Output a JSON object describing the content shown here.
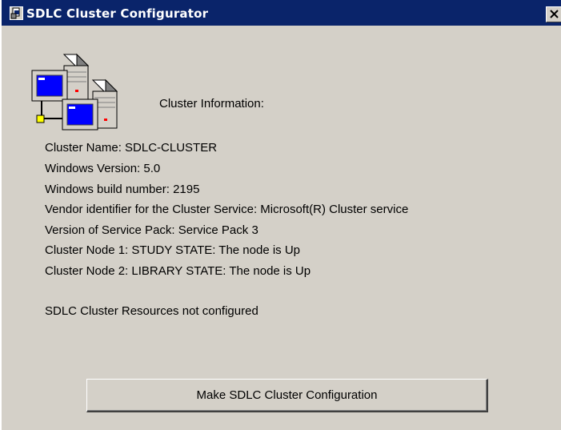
{
  "window": {
    "title": "SDLC Cluster Configurator",
    "close_glyph": "✕",
    "app_icon": "application-icon"
  },
  "main": {
    "icon": "server-cluster-icon",
    "header": "Cluster Information:",
    "info_lines": [
      "Cluster Name: SDLC-CLUSTER",
      "Windows Version: 5.0",
      "Windows build number: 2195",
      "Vendor identifier for the Cluster Service: Microsoft(R) Cluster service",
      "Version of Service Pack: Service Pack 3",
      "Cluster Node 1: STUDY STATE: The node is Up",
      "Cluster Node 2: LIBRARY STATE: The node is Up"
    ],
    "status": "SDLC Cluster Resources not configured",
    "action_button_label": "Make SDLC Cluster Configuration"
  },
  "colors": {
    "titlebar": "#0a246a",
    "dialog_face": "#d4d0c8",
    "screen_blue": "#0000ff",
    "indicator_red": "#ff0000",
    "connector_yellow": "#ffff00"
  }
}
